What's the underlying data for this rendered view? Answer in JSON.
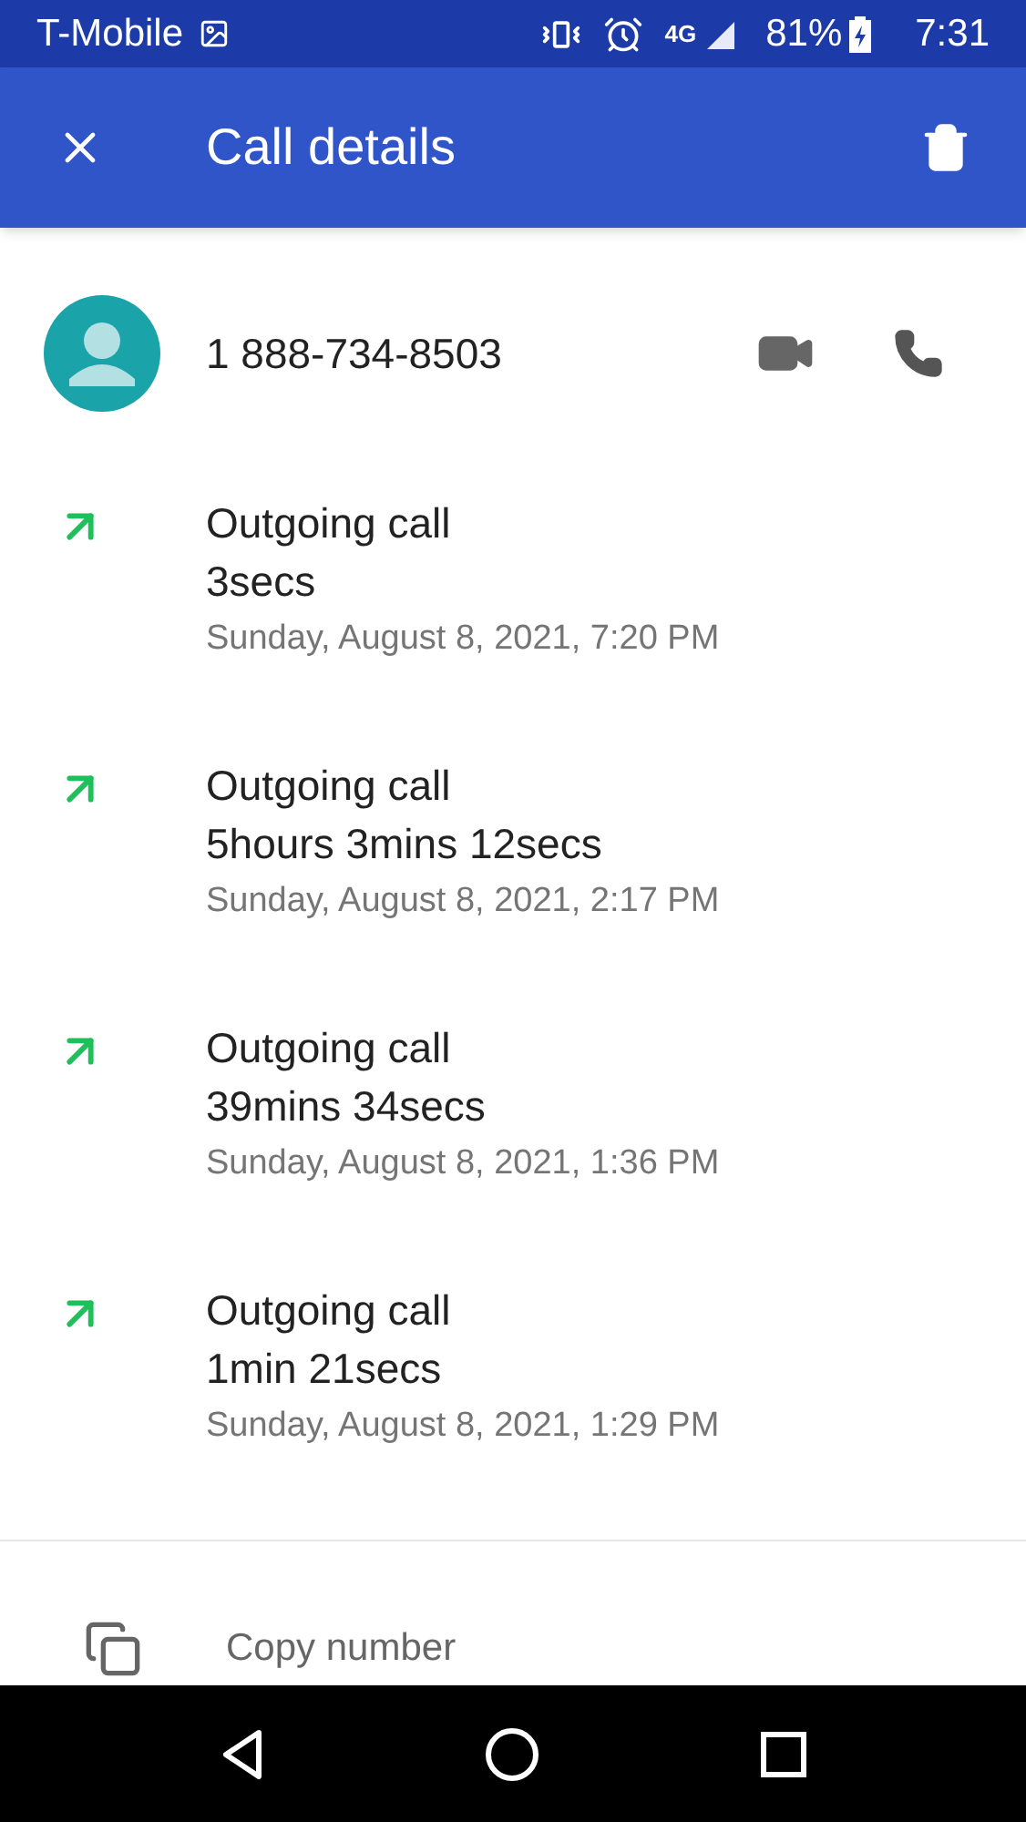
{
  "status_bar": {
    "carrier": "T-Mobile",
    "network": "4G",
    "battery": "81%",
    "time": "7:31"
  },
  "app_bar": {
    "title": "Call details"
  },
  "contact": {
    "number": "1 888-734-8503"
  },
  "calls": [
    {
      "type": "Outgoing call",
      "duration": "3secs",
      "date": "Sunday, August 8, 2021, 7:20 PM"
    },
    {
      "type": "Outgoing call",
      "duration": "5hours 3mins 12secs",
      "date": "Sunday, August 8, 2021, 2:17 PM"
    },
    {
      "type": "Outgoing call",
      "duration": "39mins 34secs",
      "date": "Sunday, August 8, 2021, 1:36 PM"
    },
    {
      "type": "Outgoing call",
      "duration": "1min 21secs",
      "date": "Sunday, August 8, 2021, 1:29 PM"
    }
  ],
  "actions": [
    {
      "label": "Copy number"
    }
  ]
}
